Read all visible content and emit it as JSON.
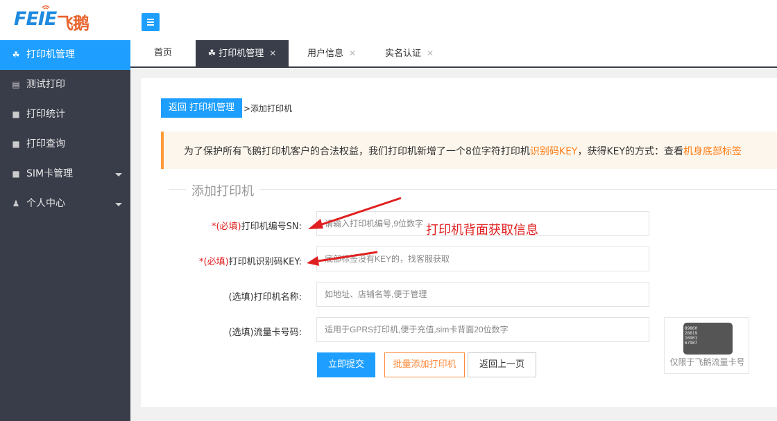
{
  "brand": {
    "logo_latin": "FEIE",
    "logo_cn": "飞鹅"
  },
  "header": {
    "menu_toggle_icon": "hamburger-icon"
  },
  "sidebar": {
    "items": [
      {
        "label": "打印机管理",
        "icon": "printer-group-icon",
        "active": true
      },
      {
        "label": "测试打印",
        "icon": "document-icon"
      },
      {
        "label": "打印统计",
        "icon": "monitor-icon"
      },
      {
        "label": "打印查询",
        "icon": "monitor-icon"
      },
      {
        "label": "SIM卡管理",
        "icon": "monitor-icon",
        "expandable": true
      },
      {
        "label": "个人中心",
        "icon": "user-icon",
        "expandable": true
      }
    ]
  },
  "tabs": [
    {
      "label": "首页",
      "closable": false
    },
    {
      "label": "打印机管理",
      "closable": true,
      "active": true
    },
    {
      "label": "用户信息",
      "closable": true
    },
    {
      "label": "实名认证",
      "closable": true
    }
  ],
  "tab_close_glyph": "✕",
  "breadcrumb": {
    "back_label": "返回 打印机管理",
    "current": ">添加打印机"
  },
  "notice": {
    "prefix": "为了保护所有飞鹅打印机客户的合法权益，我们打印机新增了一个8位字符打印机",
    "highlight1": "识别码KEY",
    "middle": "，获得KEY的方式：查看",
    "highlight2": "机身底部标签"
  },
  "form": {
    "legend": "添加打印机",
    "fields": [
      {
        "required_tag": "*(必填)",
        "label": "打印机编号SN:",
        "placeholder": "请输入打印机编号,9位数字"
      },
      {
        "required_tag": "*(必填)",
        "label": "打印机识别码KEY:",
        "placeholder": "底部标签没有KEY的，找客服获取"
      },
      {
        "required_tag": "",
        "label": "(选填)打印机名称:",
        "placeholder": "如地址、店铺名等,便于管理"
      },
      {
        "required_tag": "",
        "label": "(选填)流量卡号码:",
        "placeholder": "适用于GPRS打印机,便于充值,sim卡背面20位数字"
      }
    ],
    "buttons": {
      "submit": "立即提交",
      "batch_add": "批量添加打印机",
      "back": "返回上一页"
    }
  },
  "simcard": {
    "number_lines": "89860\n28819\n16901\n67987",
    "caption": "仅限于飞鹅流量卡号"
  },
  "annotation": {
    "text": "打印机背面获取信息",
    "color": "#e02020"
  },
  "colors": {
    "accent": "#1e9fff",
    "sidebar": "#393d49",
    "warning": "#ff8a3b",
    "required": "#e02020"
  }
}
